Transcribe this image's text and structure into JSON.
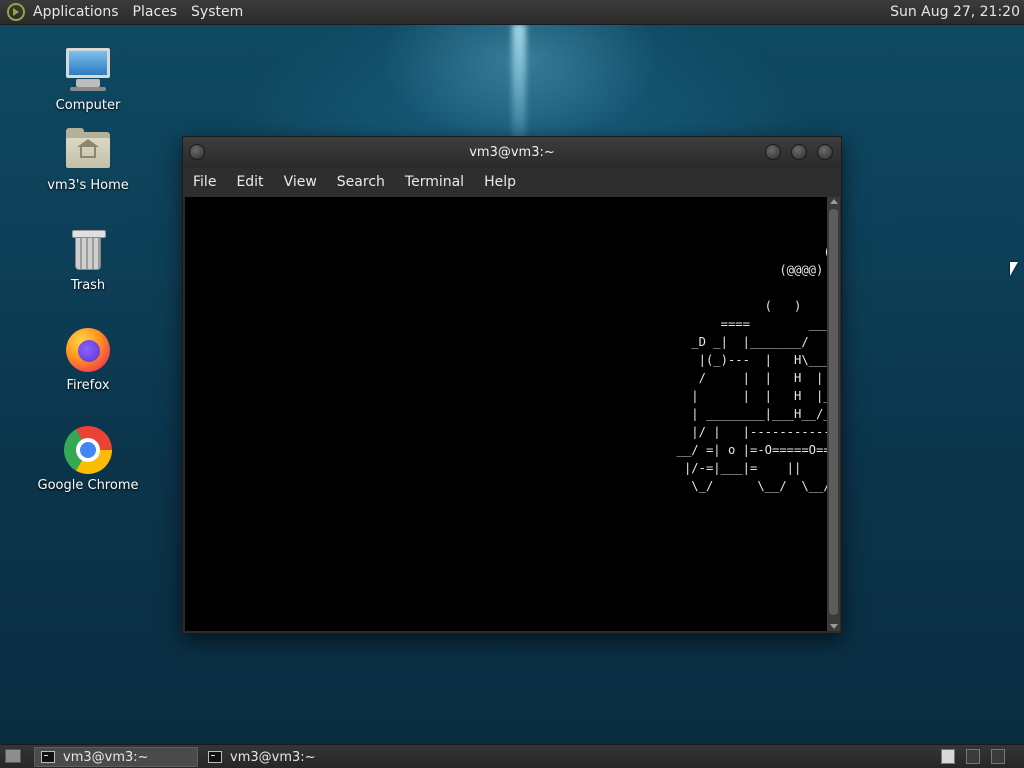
{
  "top_panel": {
    "menus": [
      "Applications",
      "Places",
      "System"
    ],
    "clock": "Sun Aug 27, 21:20"
  },
  "desktop_icons": [
    {
      "label": "Computer",
      "icon": "computer-icon"
    },
    {
      "label": "vm3's Home",
      "icon": "home-folder-icon"
    },
    {
      "label": "Trash",
      "icon": "trash-icon"
    },
    {
      "label": "Firefox",
      "icon": "firefox-icon"
    },
    {
      "label": "Google Chrome",
      "icon": "chrome-icon"
    }
  ],
  "terminal": {
    "title": "vm3@vm3:~",
    "menu": [
      "File",
      "Edit",
      "View",
      "Search",
      "Terminal",
      "Help"
    ],
    "output": "                                                                                                  (  ) (\n                                                                                            (@@@)\n                                                                                       (    )\n                                                                                 (@@@@)\n\n                                                                               (   )\n                                                                         ====        ________\n                                                                     _D _|  |_______/        \\__\n                                                                      |(_)---  |   H\\________/ |\n                                                                      /     |  |   H  |  |     |\n                                                                     |      |  |   H  |__-------\n                                                                     | ________|___H__/__|_____/\n                                                                     |/ |   |-----------I_____I\n                                                                   __/ =| o |=-O=====O=====O====\n                                                                    |/-=|___|=    ||    ||    ||\n                                                                     \\_/      \\__/  \\__/  \\__/"
  },
  "bottom_panel": {
    "tasks": [
      {
        "label": "vm3@vm3:~",
        "active": true
      },
      {
        "label": "vm3@vm3:~",
        "active": false
      }
    ]
  },
  "colors": {
    "desktop_bg": "#0d3f57",
    "panel_bg": "#2f2f2f",
    "terminal_bg": "#000000",
    "terminal_fg": "#e6e6e6"
  }
}
